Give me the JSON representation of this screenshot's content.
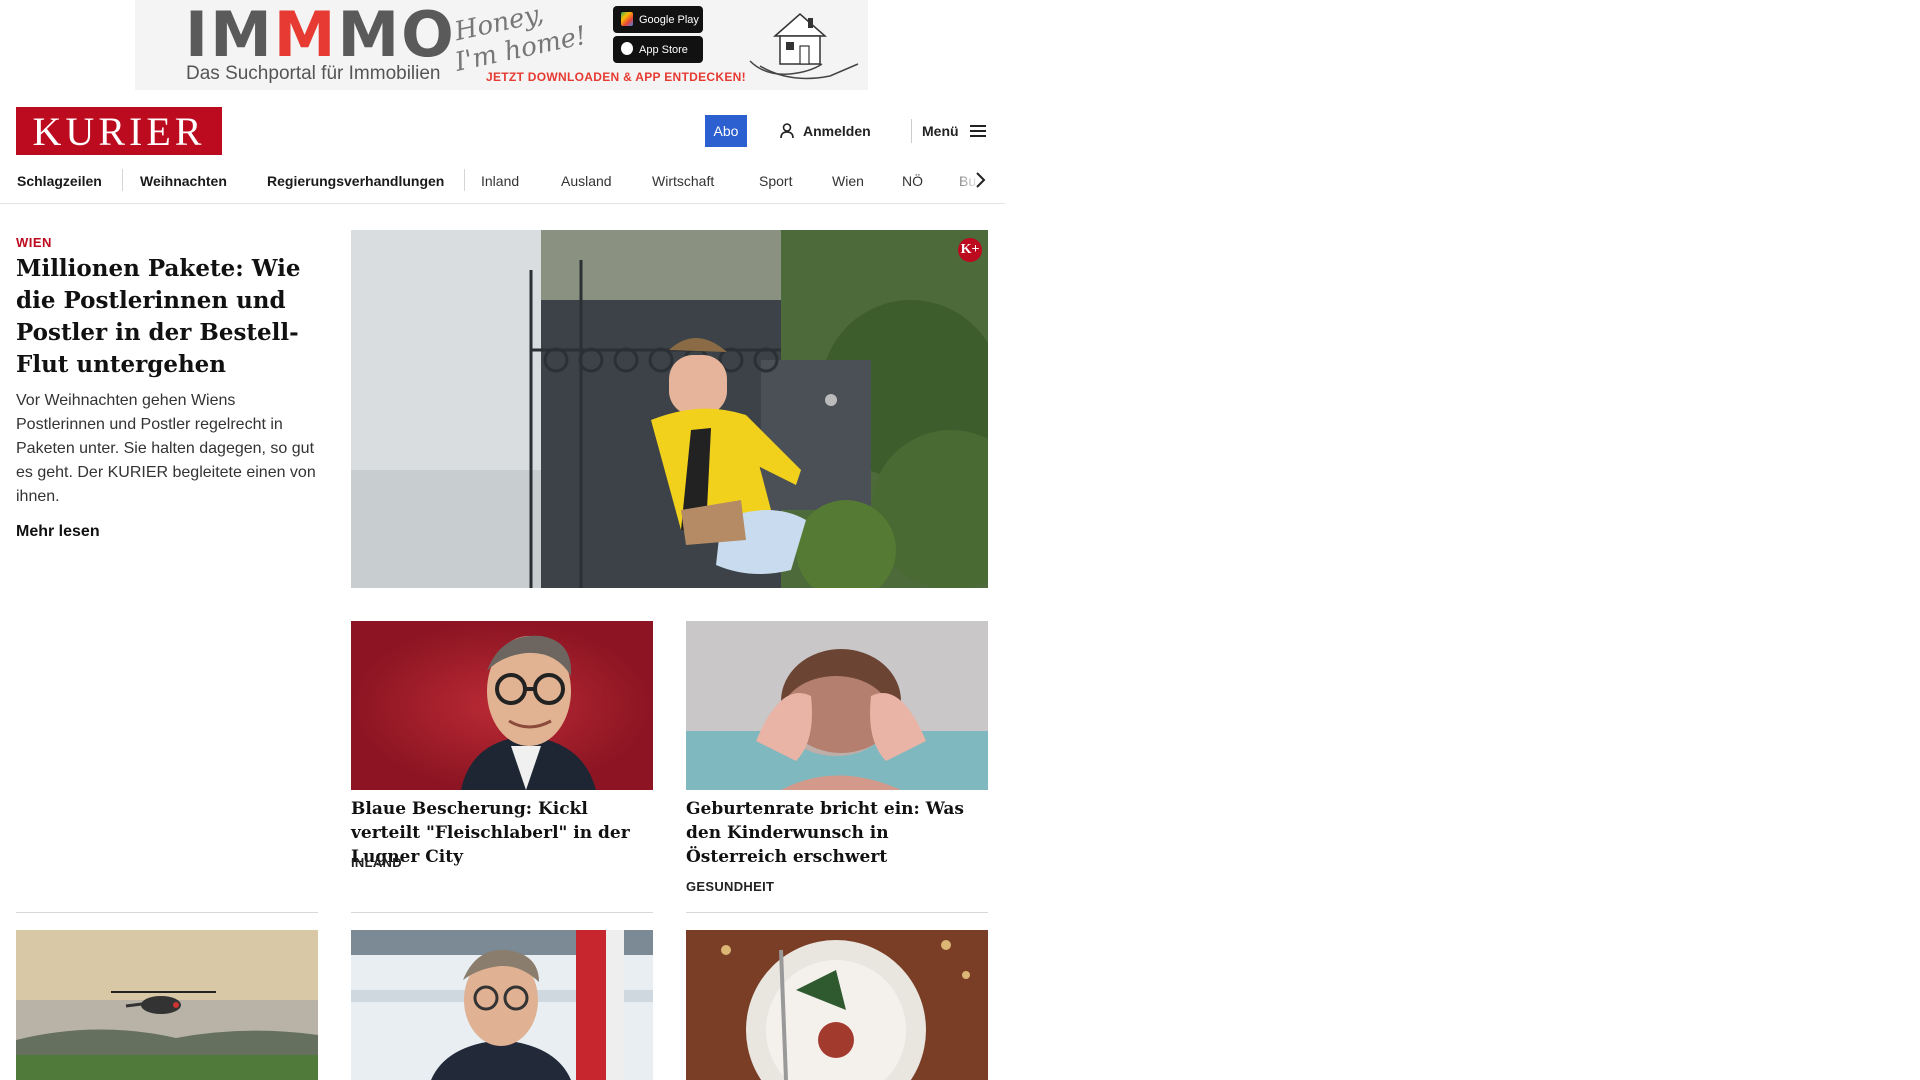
{
  "ad": {
    "brand_prefix": "IM",
    "brand_m": "M",
    "brand_suffix": "MO",
    "tagline": "Das Suchportal für Immobilien",
    "script_line1": "Honey,",
    "script_line2": "I'm home!",
    "google_play": "Google Play",
    "app_store": "App Store",
    "cta": "JETZT DOWNLOADEN & APP ENTDECKEN!"
  },
  "header": {
    "logo": "KURIER",
    "abo_label": "Abo",
    "login_label": "Anmelden",
    "menu_label": "Menü"
  },
  "nav": {
    "items": [
      "Schlagzeilen",
      "Weihnachten",
      "Regierungsverhandlungen",
      "Inland",
      "Ausland",
      "Wirtschaft",
      "Sport",
      "Wien",
      "NÖ",
      "Bu"
    ]
  },
  "lead": {
    "category": "WIEN",
    "title": "Millionen Pakete: Wie die Postlerinnen und Postler in der Bestell-Flut untergehen",
    "teaser": "Vor Weihnachten gehen Wiens Postlerinnen und Postler regelrecht in Paketen unter. Sie halten dagegen, so gut es geht. Der KURIER begleitete einen von ihnen.",
    "more_label": "Mehr lesen",
    "badge": "K+"
  },
  "cards": [
    {
      "title": "Blaue Bescherung: Kickl verteilt \"Fleischlaberl\" in der Lugner City",
      "category": "INLAND"
    },
    {
      "title": "Geburtenrate bricht ein: Was den Kinderwunsch in Österreich erschwert",
      "category": "GESUNDHEIT"
    }
  ],
  "colors": {
    "brand_red": "#bc0a1e",
    "abo_blue": "#2c5fcf"
  }
}
